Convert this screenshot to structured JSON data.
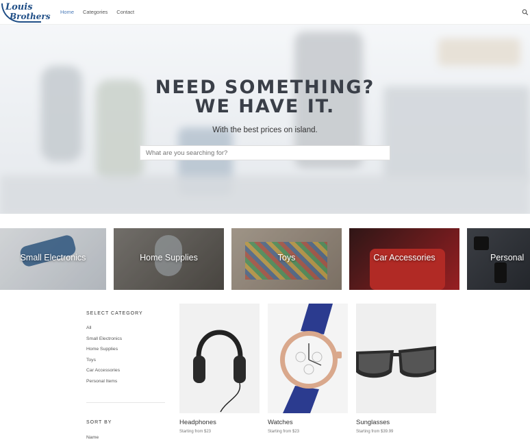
{
  "brand": {
    "line1": "Louis",
    "line2": "Brothers"
  },
  "nav": {
    "items": [
      {
        "label": "Home",
        "active": true
      },
      {
        "label": "Categories",
        "active": false
      },
      {
        "label": "Contact",
        "active": false
      }
    ]
  },
  "hero": {
    "title_line1": "NEED SOMETHING?",
    "title_line2": "WE HAVE IT.",
    "subtitle": "With the best prices on island.",
    "search_placeholder": "What are you searching for?"
  },
  "categories": [
    {
      "label": "Small Electronics"
    },
    {
      "label": "Home Supplies"
    },
    {
      "label": "Toys"
    },
    {
      "label": "Car Accessories"
    },
    {
      "label": "Personal"
    }
  ],
  "sidebar": {
    "heading": "SELECT CATEGORY",
    "items": [
      "All",
      "Small Electronics",
      "Home Supplies",
      "Toys",
      "Car Accessories",
      "Personal Items"
    ],
    "sort_heading": "SORT BY",
    "sort_value": "Name"
  },
  "products": [
    {
      "name": "Headphones",
      "price": "Starting from $23"
    },
    {
      "name": "Watches",
      "price": "Starting from $23"
    },
    {
      "name": "Sunglasses",
      "price": "Starting from $39.99"
    }
  ],
  "colors": {
    "accent": "#4a7ab8",
    "brand": "#1f4e86"
  }
}
